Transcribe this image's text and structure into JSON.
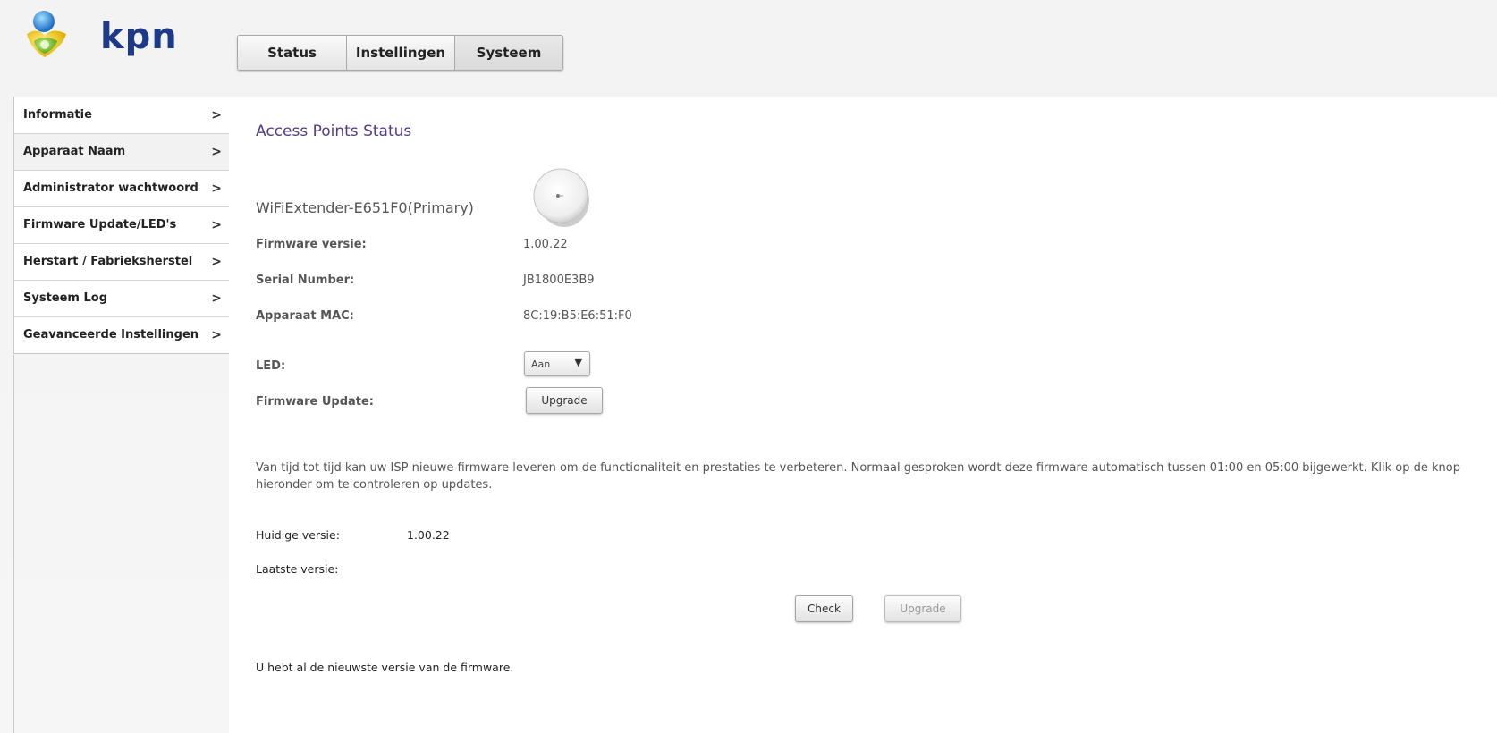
{
  "header": {
    "logo_text": "kpn",
    "tabs": [
      {
        "label": "Status",
        "active": false
      },
      {
        "label": "Instellingen",
        "active": false
      },
      {
        "label": "Systeem",
        "active": true
      }
    ]
  },
  "sidebar": {
    "items": [
      {
        "label": "Informatie",
        "active": false
      },
      {
        "label": "Apparaat Naam",
        "active": true
      },
      {
        "label": "Administrator wachtwoord",
        "active": false
      },
      {
        "label": "Firmware Update/LED's",
        "active": false
      },
      {
        "label": "Herstart / Fabrieksherstel",
        "active": false
      },
      {
        "label": "Systeem Log",
        "active": false
      },
      {
        "label": "Geavanceerde Instellingen",
        "active": false
      }
    ],
    "chevron": ">"
  },
  "main": {
    "title": "Access Points Status",
    "device_name": "WiFiExtender-E651F0(Primary)",
    "info": {
      "firmware_label": "Firmware versie:",
      "firmware_value": "1.00.22",
      "serial_label": "Serial Number:",
      "serial_value": "JB1800E3B9",
      "mac_label": "Apparaat MAC:",
      "mac_value": "8C:19:B5:E6:51:F0",
      "led_label": "LED:",
      "led_value": "Aan",
      "firmware_update_label": "Firmware Update:",
      "upgrade_button": "Upgrade"
    },
    "description": "Van tijd tot tijd kan uw ISP nieuwe firmware leveren om de functionaliteit en prestaties te verbeteren. Normaal gesproken wordt deze firmware automatisch tussen 01:00 en 05:00 bijgewerkt. Klik op de knop hieronder om te controleren op updates.",
    "current_version_label": "Huidige versie:",
    "current_version_value": "1.00.22",
    "latest_version_label": "Laatste versie:",
    "latest_version_value": "",
    "check_button": "Check",
    "upgrade_button_2": "Upgrade",
    "status_message": "U hebt al de nieuwste versie van de firmware."
  },
  "colors": {
    "brand_blue": "#1d3a8a",
    "title_purple": "#553c87"
  }
}
